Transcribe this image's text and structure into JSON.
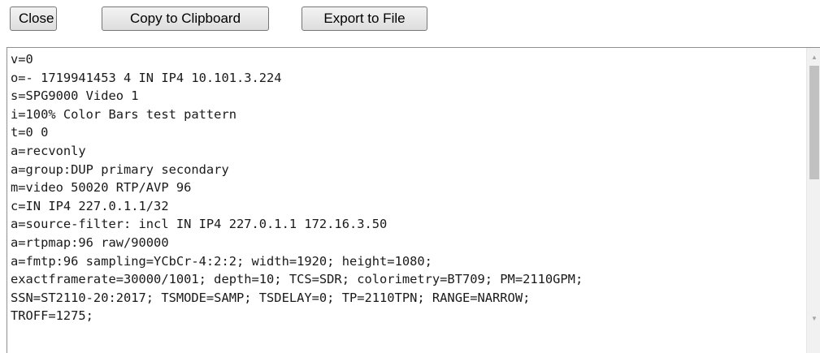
{
  "toolbar": {
    "close_label": "Close",
    "copy_label": "Copy to Clipboard",
    "export_label": "Export to File"
  },
  "sdp": {
    "text": "v=0\no=- 1719941453 4 IN IP4 10.101.3.224\ns=SPG9000 Video 1\ni=100% Color Bars test pattern\nt=0 0\na=recvonly\na=group:DUP primary secondary\nm=video 50020 RTP/AVP 96\nc=IN IP4 227.0.1.1/32\na=source-filter: incl IN IP4 227.0.1.1 172.16.3.50\na=rtpmap:96 raw/90000\na=fmtp:96 sampling=YCbCr-4:2:2; width=1920; height=1080;\nexactframerate=30000/1001; depth=10; TCS=SDR; colorimetry=BT709; PM=2110GPM;\nSSN=ST2110-20:2017; TSMODE=SAMP; TSDELAY=0; TP=2110TPN; RANGE=NARROW;\nTROFF=1275;"
  },
  "icons": {
    "scroll_up": "scroll-up-arrow",
    "scroll_down": "scroll-down-arrow"
  }
}
